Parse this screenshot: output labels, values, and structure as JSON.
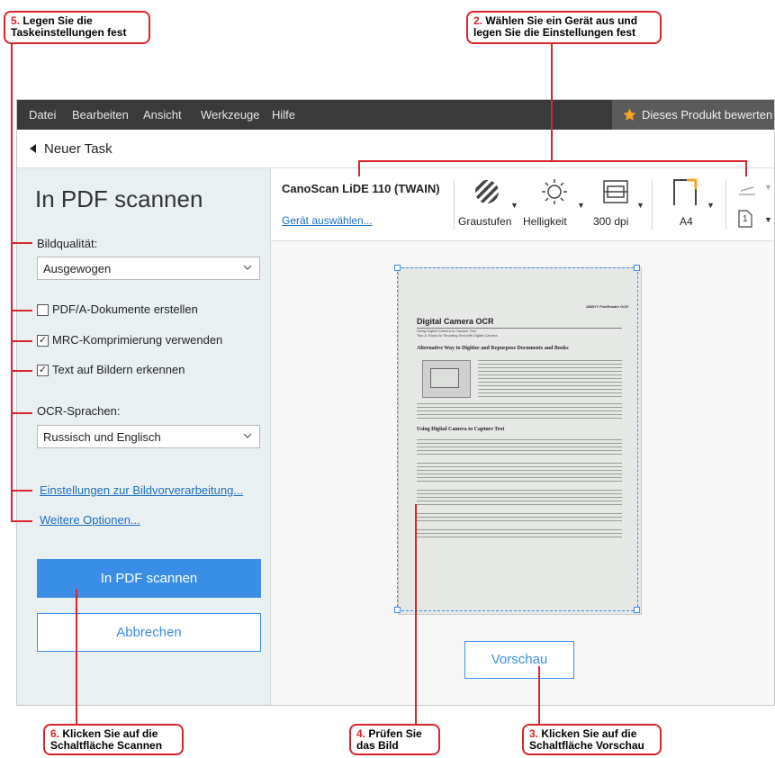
{
  "callouts": {
    "c5": {
      "num": "5.",
      "line1": "Legen Sie die",
      "line2": "Taskeinstellungen fest"
    },
    "c2": {
      "num": "2.",
      "line1": "Wählen Sie ein Gerät aus und",
      "line2": "legen Sie die Einstellungen fest"
    },
    "c6": {
      "num": "6.",
      "line1": "Klicken Sie auf die",
      "line2": "Schaltfläche Scannen"
    },
    "c4": {
      "num": "4.",
      "line1": "Prüfen Sie",
      "line2": "das Bild"
    },
    "c3": {
      "num": "3.",
      "line1": "Klicken Sie auf die",
      "line2": "Schaltfläche Vorschau"
    }
  },
  "menu": {
    "datei": "Datei",
    "bearbeiten": "Bearbeiten",
    "ansicht": "Ansicht",
    "werkzeuge": "Werkzeuge",
    "hilfe": "Hilfe",
    "rate": "Dieses Produkt bewerten"
  },
  "nav": {
    "back_label": "Neuer Task"
  },
  "sidebar": {
    "title": "In PDF scannen",
    "quality_label": "Bildqualität:",
    "quality_value": "Ausgewogen",
    "pdfa_label": "PDF/A-Dokumente erstellen",
    "pdfa_checked": false,
    "mrc_label": "MRC-Komprimierung verwenden",
    "mrc_checked": true,
    "ocr_text_label": "Text auf Bildern erkennen",
    "ocr_text_checked": true,
    "ocr_lang_label": "OCR-Sprachen:",
    "ocr_lang_value": "Russisch und Englisch",
    "preprocess_link": "Einstellungen zur Bildvorverarbeitung...",
    "more_options_link": "Weitere Optionen...",
    "scan_button": "In PDF scannen",
    "cancel_button": "Abbrechen"
  },
  "toolbar": {
    "device_name": "CanoScan LiDE 110 (TWAIN)",
    "select_device_link": "Gerät auswählen...",
    "color_mode": "Graustufen",
    "brightness": "Helligkeit",
    "resolution": "300 dpi",
    "paper_size": "A4",
    "page_num": "1"
  },
  "preview": {
    "header_right": "ABBYY FineReader OCR",
    "heading1": "Digital Camera OCR",
    "sub1": "Using Digital Camera to Capture Text",
    "sub2": "Tips & Tricks for Shooting Text with Digital Camera",
    "heading2": "Alternative Way to Digitize and Repurpose Documents and Books",
    "heading3": "Using Digital Camera to Capture Text",
    "button": "Vorschau"
  },
  "colors": {
    "accent": "#3a8ee6",
    "callout_red": "#d9262c",
    "menubar": "#3a3a3a",
    "star": "#f5a623"
  }
}
